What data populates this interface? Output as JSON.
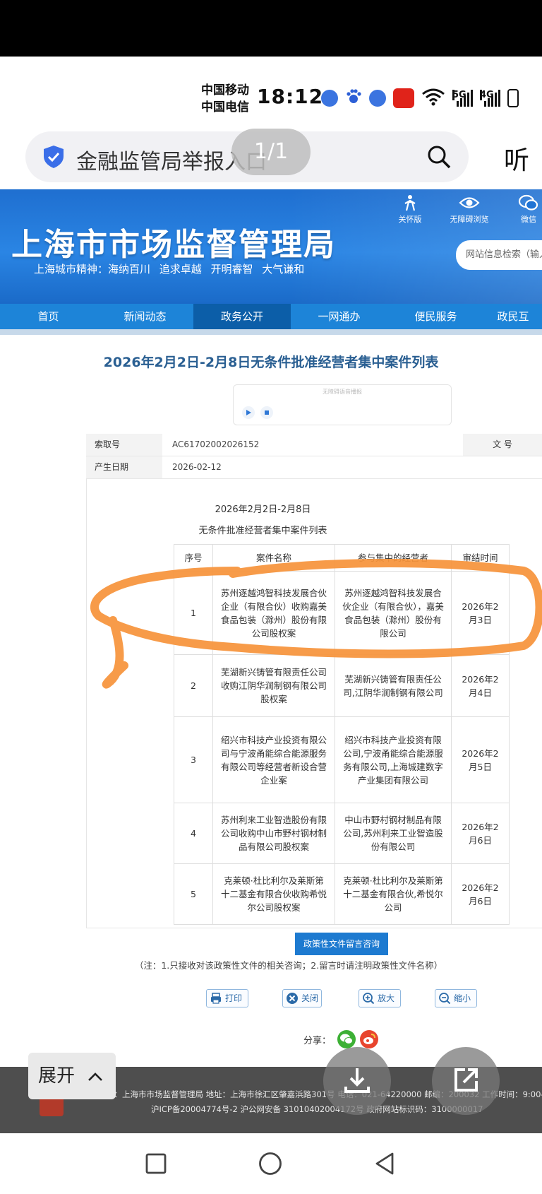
{
  "status_bar": {
    "carrier_1": "中国移动",
    "carrier_2": "中国电信",
    "time": "18:12",
    "net_1": "5G",
    "net_2": "4G"
  },
  "browser": {
    "search_text": "金融监管局举报入口",
    "page_counter": "1/1",
    "listen_label": "听"
  },
  "site": {
    "title": "上海市市场监督管理局",
    "slogan": "上海城市精神：海纳百川   追求卓越   开明睿智   大气谦和",
    "tools": [
      "关怀版",
      "无障碍浏览",
      "微信"
    ],
    "search_placeholder": "网站信息检索（输入",
    "nav": [
      "首页",
      "新闻动态",
      "政务公开",
      "一网通办",
      "便民服务",
      "政民互"
    ]
  },
  "article": {
    "title": "2026年2月2日-2月8日无条件批准经营者集中案件列表",
    "player_caption": "无障碍语音播报",
    "meta": {
      "index_label": "索取号",
      "index_value": "AC61702002026152",
      "doc_no_label": "文  号",
      "date_label": "产生日期",
      "date_value": "2026-02-12"
    },
    "doc_date": "2026年2月2日-2月8日",
    "doc_subtitle": "无条件批准经营者集中案件列表",
    "table": {
      "headers": [
        "序号",
        "案件名称",
        "参与集中的经营者",
        "审结时间"
      ],
      "rows": [
        {
          "no": "1",
          "case": "苏州逐越鸿智科技发展合伙企业（有限合伙）收购嘉美食品包装（滁州）股份有限公司股权案",
          "parties": "苏州逐越鸿智科技发展合伙企业（有限合伙），嘉美食品包装（滁州）股份有限公司",
          "date": "2026年2月3日"
        },
        {
          "no": "2",
          "case": "芜湖新兴铸管有限责任公司收购江阴华润制钢有限公司股权案",
          "parties": "芜湖新兴铸管有限责任公司,江阴华润制钢有限公司",
          "date": "2026年2月4日"
        },
        {
          "no": "3",
          "case": "绍兴市科技产业投资有限公司与宁波甬能综合能源服务有限公司等经营者新设合营企业案",
          "parties": "绍兴市科技产业投资有限公司,宁波甬能综合能源服务有限公司,上海城建数字产业集团有限公司",
          "date": "2026年2月5日"
        },
        {
          "no": "4",
          "case": "苏州利来工业智造股份有限公司收购中山市野村钢材制品有限公司股权案",
          "parties": "中山市野村钢材制品有限公司,苏州利来工业智造股份有限公司",
          "date": "2026年2月6日"
        },
        {
          "no": "5",
          "case": "克莱顿·杜比利尔及莱斯第十二基金有限合伙收购希悦尔公司股权案",
          "parties": "克莱顿·杜比利尔及莱斯第十二基金有限合伙,希悦尔公司",
          "date": "2026年2月6日"
        }
      ]
    },
    "consult_button": "政策性文件留言咨询",
    "consult_note": "（注：1.只接收对该政策性文件的相关咨询；2.留言时请注明政策性文件名称）",
    "tools": {
      "print": "打印",
      "close": "关闭",
      "zoom_in": "放大",
      "zoom_out": "缩小"
    },
    "share_label": "分享："
  },
  "footer": {
    "line1": "有：上海市市场监督管理局 地址：上海市徐汇区肇嘉浜路301号 电话：021-64220000 邮编：200032 工作时间：9:00--1",
    "line2": "沪ICP备20004774号-2   沪公网安备 31010402004172号   政府网站标识码：3100000017"
  },
  "overlay": {
    "expand_label": "展开"
  },
  "colors": {
    "header_blue": "#2a85e4",
    "nav_blue": "#1d84d8",
    "nav_active": "#0c5ea8",
    "title_blue": "#2a5f92",
    "highlight_orange": "#f6923a",
    "footer_gray": "#4e4e4e"
  }
}
